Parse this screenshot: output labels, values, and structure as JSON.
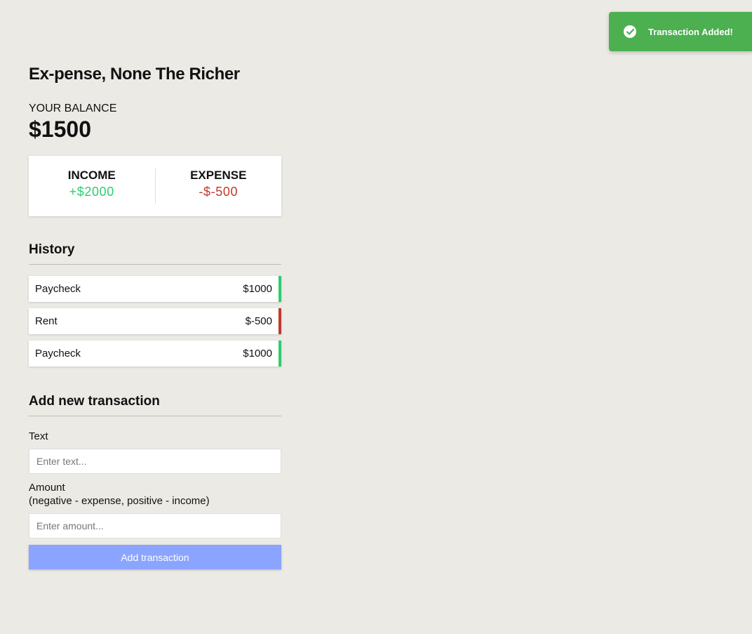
{
  "app": {
    "title": "Ex-pense, None The Richer"
  },
  "balance": {
    "label": "YOUR BALANCE",
    "value": "$1500"
  },
  "summary": {
    "income_label": "INCOME",
    "income_value": "+$2000",
    "expense_label": "EXPENSE",
    "expense_value": "-$-500"
  },
  "history": {
    "title": "History",
    "items": [
      {
        "text": "Paycheck",
        "amount": "$1000",
        "type": "income"
      },
      {
        "text": "Rent",
        "amount": "$-500",
        "type": "expense"
      },
      {
        "text": "Paycheck",
        "amount": "$1000",
        "type": "income"
      }
    ]
  },
  "form": {
    "title": "Add new transaction",
    "text_label": "Text",
    "text_placeholder": "Enter text...",
    "amount_label": "Amount",
    "amount_hint": "(negative - expense, positive - income)",
    "amount_placeholder": "Enter amount...",
    "submit_label": "Add transaction"
  },
  "toast": {
    "message": "Transaction Added!",
    "icon": "check-circle-icon"
  },
  "colors": {
    "income": "#2ecc71",
    "expense": "#c0392b",
    "button": "#8aa4ff",
    "toast": "#4caf50",
    "background": "#eceae5"
  }
}
